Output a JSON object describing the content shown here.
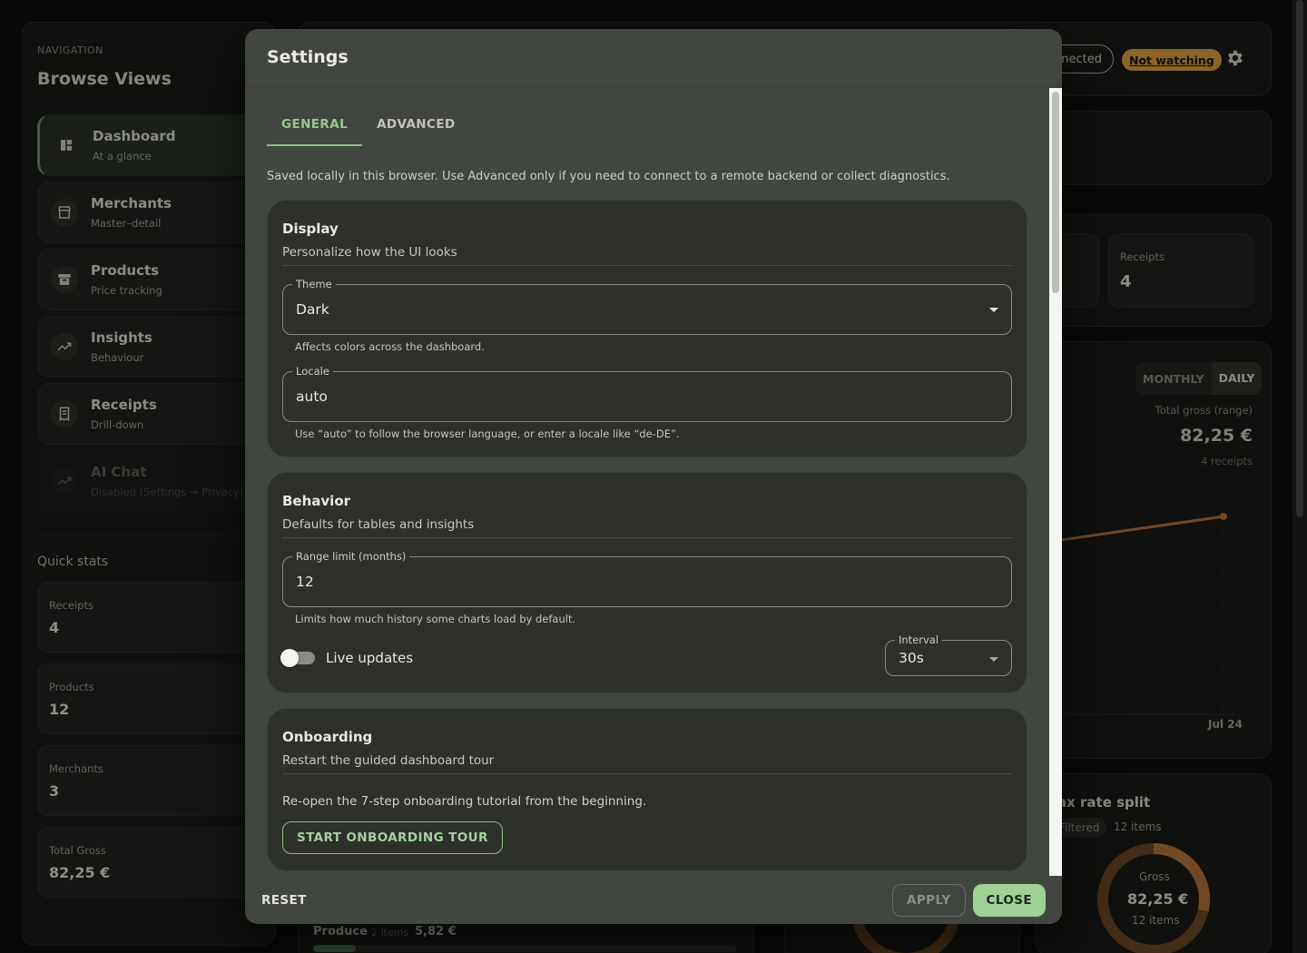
{
  "sidebar": {
    "caption": "NAVIGATION",
    "title": "Browse Views",
    "items": [
      {
        "label": "Dashboard",
        "sub": "At a glance"
      },
      {
        "label": "Merchants",
        "sub": "Master–detail"
      },
      {
        "label": "Products",
        "sub": "Price tracking"
      },
      {
        "label": "Insights",
        "sub": "Behaviour"
      },
      {
        "label": "Receipts",
        "sub": "Drill-down"
      },
      {
        "label": "AI Chat",
        "sub": "Disabled (Settings → Privacy)"
      }
    ],
    "quick_stats_title": "Quick stats",
    "quick_stats": [
      {
        "label": "Receipts",
        "value": "4"
      },
      {
        "label": "Products",
        "value": "12"
      },
      {
        "label": "Merchants",
        "value": "3"
      },
      {
        "label": "Total Gross",
        "value": "82,25 €"
      }
    ]
  },
  "topbar": {
    "connection_label": "nected",
    "watch_badge": "Not watching"
  },
  "background": {
    "receipts_label": "Receipts",
    "receipts_value": "4",
    "seg_monthly": "MONTHLY",
    "seg_daily": "DAILY",
    "range_label": "Total gross (range)",
    "range_value": "82,25 €",
    "range_sub": "4 receipts",
    "x_tick": "Jul 24",
    "tax_title": "ax rate split",
    "tax_chip": "Filtered",
    "tax_items": "12 items",
    "donut_label": "Gross",
    "donut_value": "82,25 €",
    "donut_sub": "12 items",
    "produce_label": "Produce",
    "produce_count": "2 items",
    "produce_amount": "5,82 €"
  },
  "modal": {
    "title": "Settings",
    "tabs": [
      {
        "label": "GENERAL",
        "active": true
      },
      {
        "label": "ADVANCED",
        "active": false
      }
    ],
    "intro": "Saved locally in this browser. Use Advanced only if you need to connect to a remote backend or collect diagnostics.",
    "display": {
      "title": "Display",
      "subtitle": "Personalize how the UI looks",
      "theme_legend": "Theme",
      "theme_value": "Dark",
      "theme_help": "Affects colors across the dashboard.",
      "locale_legend": "Locale",
      "locale_value": "auto",
      "locale_help": "Use “auto” to follow the browser language, or enter a locale like “de-DE”."
    },
    "behavior": {
      "title": "Behavior",
      "subtitle": "Defaults for tables and insights",
      "range_legend": "Range limit (months)",
      "range_value": "12",
      "range_help": "Limits how much history some charts load by default.",
      "live_label": "Live updates",
      "interval_legend": "Interval",
      "interval_value": "30s"
    },
    "onboarding": {
      "title": "Onboarding",
      "subtitle": "Restart the guided dashboard tour",
      "text": "Re-open the 7-step onboarding tutorial from the beginning.",
      "button": "START ONBOARDING TOUR"
    },
    "footer": {
      "reset": "RESET",
      "apply": "APPLY",
      "close": "CLOSE"
    }
  },
  "colors": {
    "accent": "#9fd096",
    "badge": "#e0a341",
    "line": "#b8773a"
  }
}
